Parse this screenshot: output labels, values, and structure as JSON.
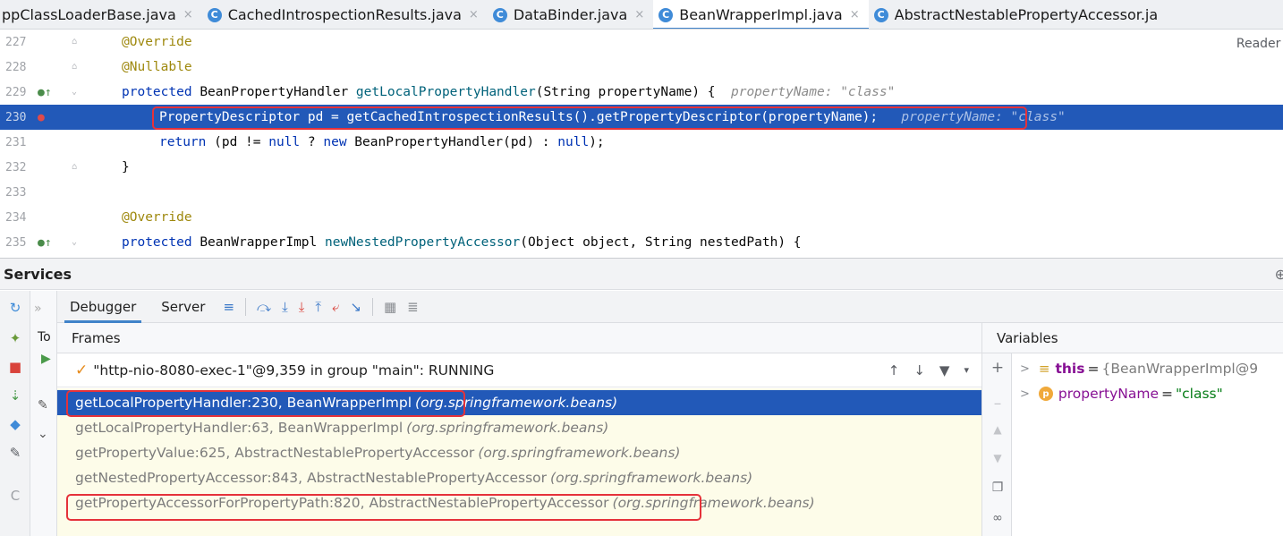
{
  "tabs": [
    {
      "label": "ppClassLoaderBase.java",
      "active": false,
      "has_icon": false
    },
    {
      "label": "CachedIntrospectionResults.java",
      "active": false,
      "has_icon": true
    },
    {
      "label": "DataBinder.java",
      "active": false,
      "has_icon": true
    },
    {
      "label": "BeanWrapperImpl.java",
      "active": true,
      "has_icon": true
    },
    {
      "label": "AbstractNestablePropertyAccessor.ja",
      "active": false,
      "has_icon": true
    }
  ],
  "tab_icon_letter": "C",
  "editor": {
    "reader_label": "Reader I",
    "lines": [
      {
        "num": "227",
        "annotation": "@Override"
      },
      {
        "num": "228",
        "annotation": "@Nullable"
      },
      {
        "num": "229",
        "kw": "protected",
        "type": "BeanPropertyHandler",
        "method": "getLocalPropertyHandler",
        "args": "(String propertyName) {",
        "inlay": "propertyName: \"class\""
      },
      {
        "num": "230",
        "code": "PropertyDescriptor pd = getCachedIntrospectionResults().getPropertyDescriptor(propertyName);",
        "inlay": "propertyName: \"class\""
      },
      {
        "num": "231",
        "kw1": "return",
        "rest1": " (pd != ",
        "kw2": "null",
        "rest2": " ? ",
        "kw3": "new",
        "rest3": " BeanPropertyHandler(pd) : ",
        "kw4": "null",
        "rest4": ");"
      },
      {
        "num": "232",
        "code": "}"
      },
      {
        "num": "233",
        "code": ""
      },
      {
        "num": "234",
        "annotation": "@Override"
      },
      {
        "num": "235",
        "kw": "protected",
        "type": "BeanWrapperImpl",
        "method": "newNestedPropertyAccessor",
        "args": "(Object object, String nestedPath) {"
      }
    ]
  },
  "services": {
    "title": "Services",
    "tree_label": "To",
    "debug_tabs": [
      "Debugger",
      "Server"
    ],
    "frames_title": "Frames",
    "variables_title": "Variables",
    "thread": "\"http-nio-8080-exec-1\"@9,359 in group \"main\": RUNNING",
    "frames": [
      {
        "name": "getLocalPropertyHandler:230, BeanWrapperImpl",
        "pkg": "(org.springframework.beans)",
        "selected": true
      },
      {
        "name": "getLocalPropertyHandler:63, BeanWrapperImpl",
        "pkg": "(org.springframework.beans)",
        "selected": false
      },
      {
        "name": "getPropertyValue:625, AbstractNestablePropertyAccessor",
        "pkg": "(org.springframework.beans)",
        "selected": false
      },
      {
        "name": "getNestedPropertyAccessor:843, AbstractNestablePropertyAccessor",
        "pkg": "(org.springframework.beans)",
        "selected": false
      },
      {
        "name": "getPropertyAccessorForPropertyPath:820, AbstractNestablePropertyAccessor",
        "pkg": "(org.springframework.beans)",
        "selected": false
      }
    ],
    "variables": [
      {
        "icon": "field-icon",
        "name": "this",
        "eq": "=",
        "value": "{BeanWrapperImpl@9"
      },
      {
        "icon": "param-icon",
        "name": "propertyName",
        "eq": "=",
        "value": "\"class\""
      }
    ]
  },
  "colors": {
    "accent": "#2259b8",
    "highlight_box": "#e5323a",
    "frames_bg": "#fdfce9"
  }
}
